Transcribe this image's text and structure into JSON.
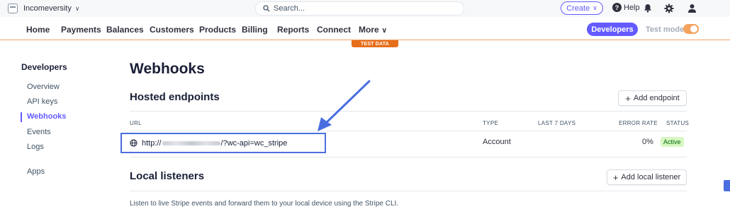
{
  "account": {
    "name": "Incomeversity"
  },
  "search": {
    "placeholder": "Search..."
  },
  "topbar": {
    "create_label": "Create",
    "help_label": "Help"
  },
  "nav": {
    "items": [
      "Home",
      "Payments",
      "Balances",
      "Customers",
      "Products",
      "Billing",
      "Reports",
      "Connect",
      "More"
    ],
    "developers_label": "Developers",
    "test_mode_label": "Test mode",
    "test_mode_on": true,
    "test_data_banner": "TEST DATA"
  },
  "sidebar": {
    "title": "Developers",
    "items": [
      "Overview",
      "API keys",
      "Webhooks",
      "Events",
      "Logs",
      "Apps"
    ],
    "active": "Webhooks"
  },
  "page": {
    "title": "Webhooks"
  },
  "hosted": {
    "title": "Hosted endpoints",
    "add_label": "Add endpoint",
    "columns": [
      "URL",
      "TYPE",
      "LAST 7 DAYS",
      "ERROR RATE",
      "STATUS"
    ],
    "rows": [
      {
        "url_prefix": "http://",
        "url_suffix": "/?wc-api=wc_stripe",
        "type": "Account",
        "last7": "",
        "error_rate": "0%",
        "status": "Active"
      }
    ]
  },
  "local": {
    "title": "Local listeners",
    "add_label": "Add local listener",
    "description": "Listen to live Stripe events and forward them to your local device using the Stripe CLI."
  },
  "colors": {
    "accent": "#635bff",
    "test_mode": "#e56f1c",
    "highlight": "#4a6ee0",
    "active_badge_bg": "#d7f7c2"
  }
}
